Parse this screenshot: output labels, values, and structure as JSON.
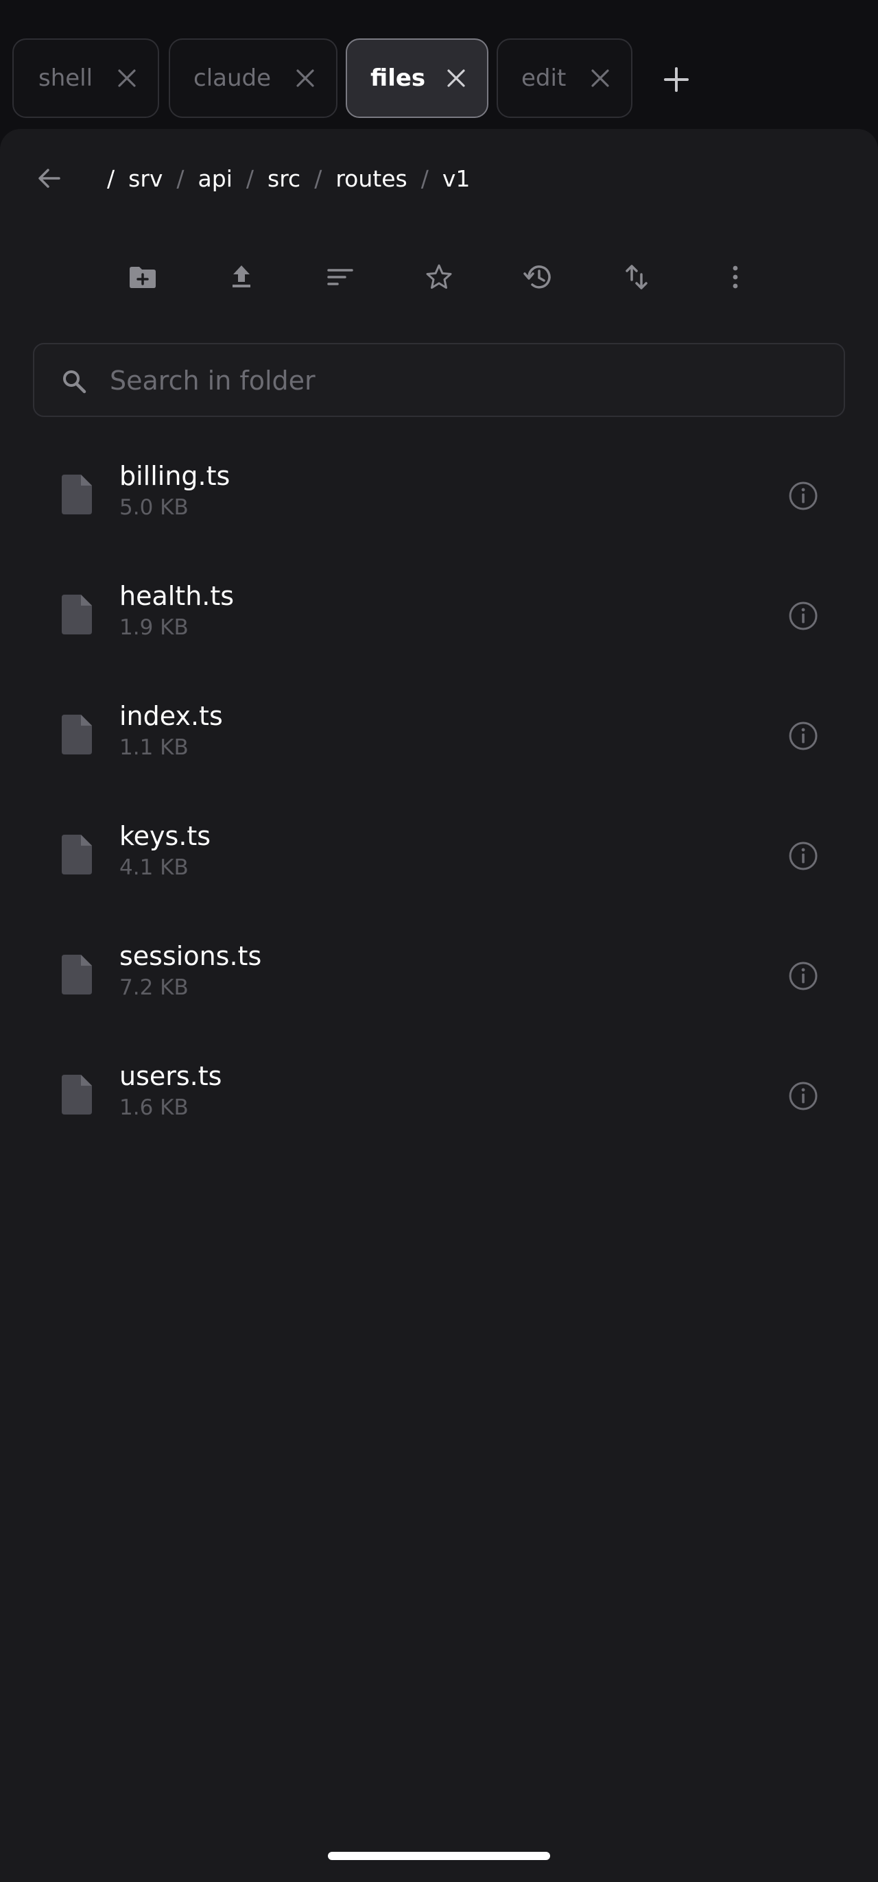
{
  "tabs": [
    {
      "label": "shell",
      "active": false
    },
    {
      "label": "claude",
      "active": false
    },
    {
      "label": "files",
      "active": true
    },
    {
      "label": "edit",
      "active": false
    }
  ],
  "breadcrumb": {
    "root": "/",
    "parts": [
      "srv",
      "api",
      "src",
      "routes",
      "v1"
    ],
    "separator": "/"
  },
  "toolbar": {
    "icons": [
      "new-folder-icon",
      "upload-icon",
      "sort-icon",
      "star-icon",
      "history-icon",
      "swap-vert-icon",
      "more-vert-icon"
    ]
  },
  "search": {
    "placeholder": "Search in folder",
    "value": ""
  },
  "files": [
    {
      "name": "billing.ts",
      "size": "5.0 KB"
    },
    {
      "name": "health.ts",
      "size": "1.9 KB"
    },
    {
      "name": "index.ts",
      "size": "1.1 KB"
    },
    {
      "name": "keys.ts",
      "size": "4.1 KB"
    },
    {
      "name": "sessions.ts",
      "size": "7.2 KB"
    },
    {
      "name": "users.ts",
      "size": "1.6 KB"
    }
  ],
  "colors": {
    "background": "#0f0f12",
    "panel": "#1a1a1d",
    "text_primary": "#ffffff",
    "text_secondary": "#5d5d63",
    "icon": "#8a8a90",
    "file_icon": "#4b4b52"
  }
}
